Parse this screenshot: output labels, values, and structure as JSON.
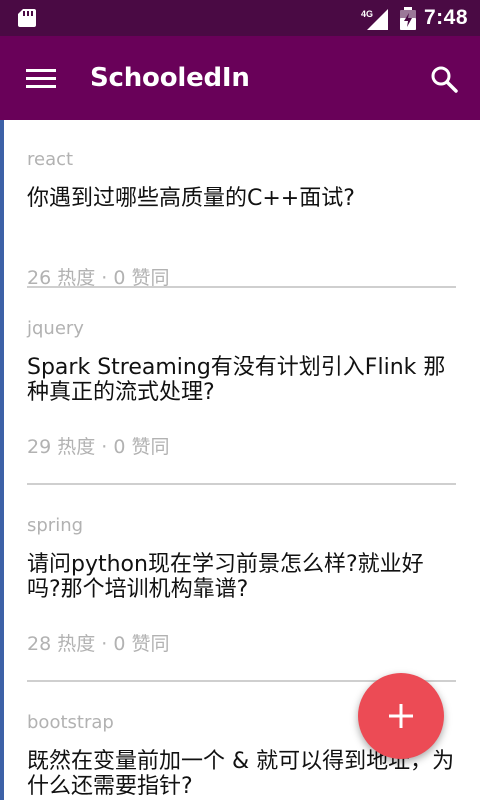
{
  "status_bar": {
    "time": "7:48",
    "network": "4G",
    "icons": [
      "sd-card-icon",
      "signal-icon",
      "battery-icon"
    ]
  },
  "app_bar": {
    "title": "SchooledIn",
    "icons": [
      "menu-icon",
      "search-icon"
    ]
  },
  "feed": [
    {
      "tag": "react",
      "title": "你遇到过哪些高质量的C++面试?",
      "stats": "26 热度 · 0 赞同"
    },
    {
      "tag": "jquery",
      "title": "Spark Streaming有没有计划引入Flink 那种真正的流式处理?",
      "stats": "29 热度 · 0 赞同"
    },
    {
      "tag": "spring",
      "title": "请问python现在学习前景怎么样?就业好吗?那个培训机构靠谱?",
      "stats": "28 热度 · 0 赞同"
    },
    {
      "tag": "bootstrap",
      "title": "既然在变量前加一个 & 就可以得到地址，为什么还需要指针?",
      "stats": ""
    }
  ],
  "fab": {
    "icon": "plus-icon"
  },
  "colors": {
    "status_bar": "#4a0a44",
    "app_bar": "#690159",
    "fab": "#ec4b55",
    "edge_accent": "#3d61a7",
    "muted_text": "#b2b2b2"
  }
}
